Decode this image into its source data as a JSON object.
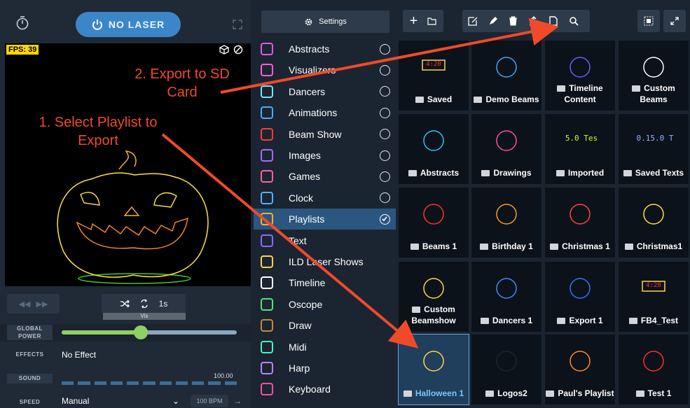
{
  "header": {
    "laser_button": "NO LASER",
    "fps": "FPS: 39"
  },
  "annotations": {
    "step2": "2. Export to SD Card",
    "step1": "1. Select Playlist to Export"
  },
  "playback": {
    "interval": "1s",
    "tab": "Vis"
  },
  "controls": {
    "power_label": "GLOBAL POWER",
    "power_level": 0.45,
    "effects_label": "EFFECTS",
    "effects_value": "No Effect",
    "sound_label": "SOUND",
    "sound_value": "100.00",
    "speed_label": "SPEED",
    "speed_value": "Manual",
    "bpm": "100 BPM"
  },
  "settings_label": "Settings",
  "categories": [
    {
      "label": "Abstracts",
      "icon": "abstracts-icon"
    },
    {
      "label": "Visualizers",
      "icon": "visualizers-icon"
    },
    {
      "label": "Dancers",
      "icon": "dancers-icon"
    },
    {
      "label": "Animations",
      "icon": "animations-icon"
    },
    {
      "label": "Beam Show",
      "icon": "beam-show-icon"
    },
    {
      "label": "Images",
      "icon": "images-icon"
    },
    {
      "label": "Games",
      "icon": "games-icon"
    },
    {
      "label": "Clock",
      "icon": "clock-icon"
    },
    {
      "label": "Playlists",
      "icon": "folder-icon",
      "selected": true
    },
    {
      "label": "Text",
      "icon": "text-icon"
    },
    {
      "label": "ILD Laser Shows",
      "icon": "ild-icon"
    },
    {
      "label": "Timeline",
      "icon": "timeline-icon"
    },
    {
      "label": "Oscope",
      "icon": "oscope-icon"
    },
    {
      "label": "Draw",
      "icon": "pencil-icon"
    },
    {
      "label": "Midi",
      "icon": "midi-icon"
    },
    {
      "label": "Harp",
      "icon": "harp-icon"
    },
    {
      "label": "Keyboard",
      "icon": "keyboard-icon"
    }
  ],
  "playlists": [
    {
      "label": "Saved"
    },
    {
      "label": "Demo Beams"
    },
    {
      "label": "Timeline Content"
    },
    {
      "label": "Custom Beams"
    },
    {
      "label": "Abstracts"
    },
    {
      "label": "Drawings"
    },
    {
      "label": "Imported",
      "preview_text": "5.0 Tes"
    },
    {
      "label": "Saved Texts",
      "preview_text": "0.15.0 T"
    },
    {
      "label": "Beams 1"
    },
    {
      "label": "Birthday 1"
    },
    {
      "label": "Christmas 1"
    },
    {
      "label": "Christmas1"
    },
    {
      "label": "Custom Beamshow"
    },
    {
      "label": "Dancers 1"
    },
    {
      "label": "Export 1"
    },
    {
      "label": "FB4_Test"
    },
    {
      "label": "Halloween 1",
      "selected": true
    },
    {
      "label": "Logos2"
    },
    {
      "label": "Paul's Playlist"
    },
    {
      "label": "Test 1"
    }
  ],
  "clock_preview": "4:20"
}
